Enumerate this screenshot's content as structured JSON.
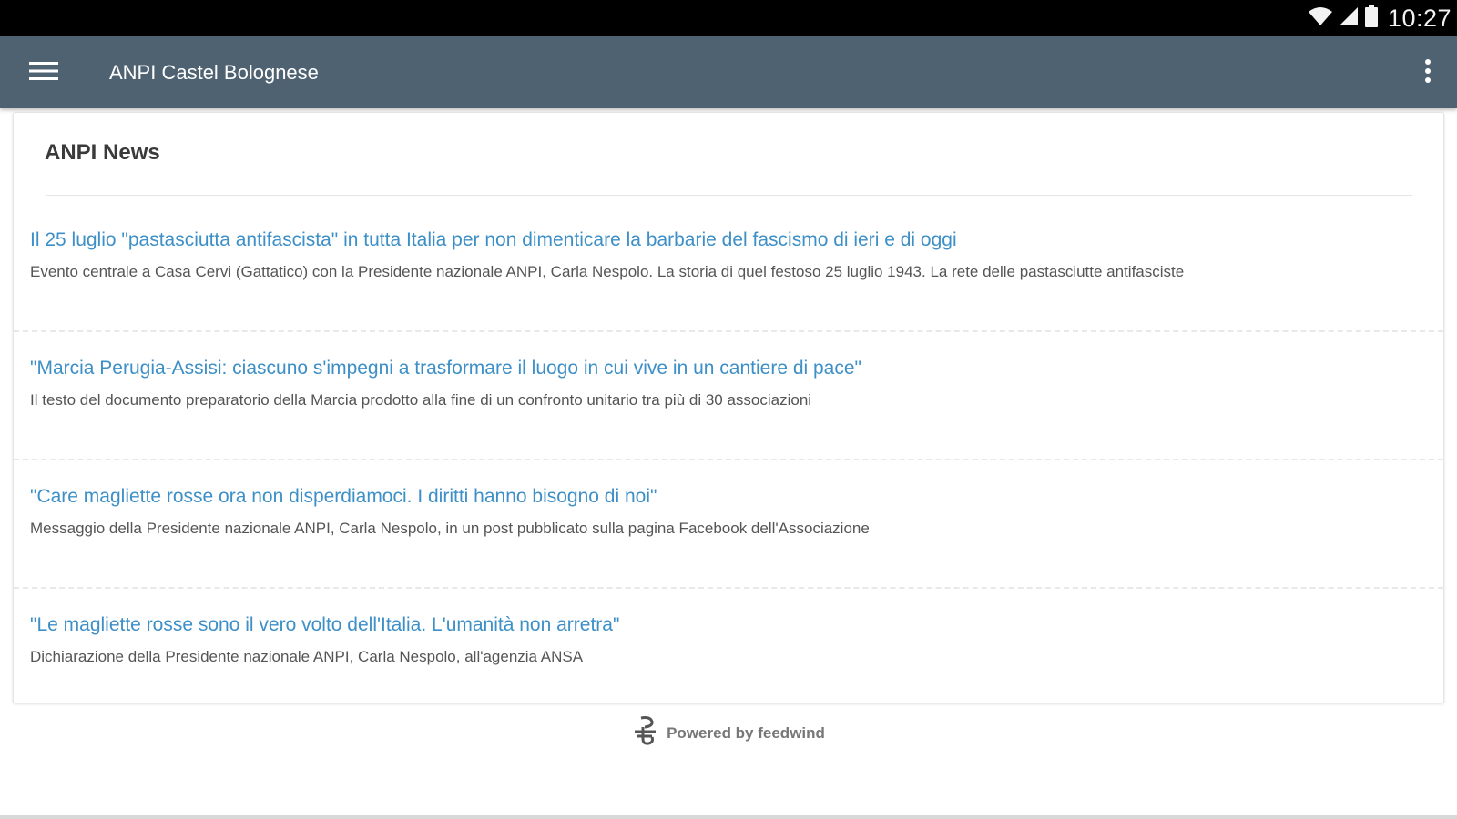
{
  "status_bar": {
    "time": "10:27",
    "icons": [
      "wifi-icon",
      "cell-signal-icon",
      "battery-icon"
    ]
  },
  "app_bar": {
    "menu_icon": "hamburger-menu-icon",
    "title": "ANPI Castel Bolognese",
    "overflow_icon": "more-vertical-icon",
    "color": "#4f6272"
  },
  "feed": {
    "title": "ANPI News",
    "items": [
      {
        "title": "Il 25 luglio \"pastasciutta antifascista\" in tutta Italia per non dimenticare la barbarie del fascismo di ieri e di oggi",
        "description": "Evento centrale a Casa Cervi (Gattatico) con la Presidente nazionale ANPI, Carla Nespolo. La storia di quel festoso 25 luglio 1943. La rete delle pastasciutte antifasciste"
      },
      {
        "title": "\"Marcia Perugia-Assisi: ciascuno s'impegni a trasformare il luogo in cui vive in un cantiere di pace\"",
        "description": "Il testo del documento preparatorio della Marcia prodotto alla fine di un confronto unitario tra più di 30 associazioni"
      },
      {
        "title": "\"Care magliette rosse ora non disperdiamoci. I diritti hanno bisogno di noi\"",
        "description": "Messaggio della Presidente nazionale ANPI, Carla Nespolo, in un post pubblicato sulla pagina Facebook dell'Associazione"
      },
      {
        "title": "\"Le magliette rosse sono il vero volto dell'Italia. L'umanità non arretra\"",
        "description": "Dichiarazione della Presidente nazionale ANPI, Carla Nespolo, all'agenzia ANSA"
      }
    ],
    "link_color": "#3d8fc7"
  },
  "footer": {
    "powered_by": "Powered by feedwind",
    "logo_icon": "feedwind-logo-icon"
  }
}
